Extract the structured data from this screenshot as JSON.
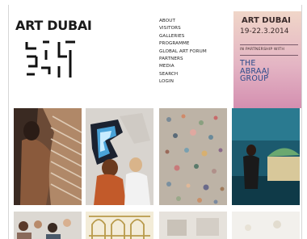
{
  "header": {
    "brand": "ART DUBAI"
  },
  "nav": {
    "items": [
      {
        "id": "about",
        "label": "ABOUT"
      },
      {
        "id": "visitors",
        "label": "VISITORS"
      },
      {
        "id": "galleries",
        "label": "GALLERIES"
      },
      {
        "id": "programme",
        "label": "PROGRAMME"
      },
      {
        "id": "global-art-forum",
        "label": "GLOBAL ART FORUM"
      },
      {
        "id": "partners",
        "label": "PARTNERS"
      },
      {
        "id": "media",
        "label": "MEDIA"
      },
      {
        "id": "search",
        "label": "SEARCH"
      },
      {
        "id": "login",
        "label": "LOGIN"
      }
    ]
  },
  "promo": {
    "title": "ART DUBAI",
    "dates": "19-22.3.2014",
    "partnership_label": "IN PARTNERSHIP WITH",
    "sponsor_lines": [
      "THE",
      "ABRAAJ",
      "GROUP"
    ]
  },
  "theme": {
    "text": "#1a1a1a",
    "promo_pink": "#e4b5c4",
    "sponsor_blue": "#2a4a8a"
  },
  "gallery": {
    "tiles": [
      {
        "name": "image-tile-textiles"
      },
      {
        "name": "image-tile-installation-visitors"
      },
      {
        "name": "image-tile-mosaic-floor"
      },
      {
        "name": "image-tile-blue-room"
      },
      {
        "name": "image-tile-crowd"
      },
      {
        "name": "image-tile-arch-ornament"
      },
      {
        "name": "image-tile-exhibition-hall"
      },
      {
        "name": "image-tile-lights"
      }
    ]
  }
}
